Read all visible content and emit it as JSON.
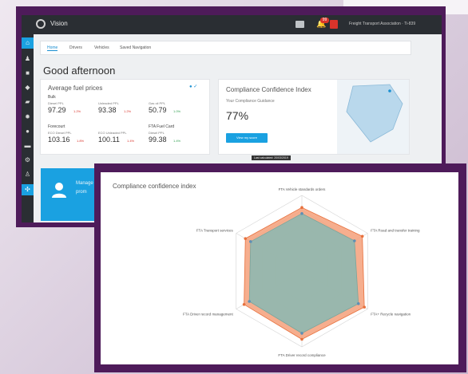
{
  "app": {
    "name": "Vision",
    "user": "Freight Transport Association · Ti-839",
    "notification_count": "99"
  },
  "nav_icons": [
    "home-icon",
    "person-icon",
    "truck-icon",
    "shirt-icon",
    "card-icon",
    "gear-icon",
    "chat-icon",
    "truck-icon",
    "tool-icon",
    "user-icon",
    "network-icon"
  ],
  "tabs": [
    "Home",
    "Drivers",
    "Vehicles",
    "Saved Navigation"
  ],
  "greeting": "Good afternoon",
  "fuel_card": {
    "title": "Average fuel prices",
    "section_bulk": "Bulk",
    "section_forecourt": "Forecourt",
    "section_fta": "FTA Fuel Card",
    "rows": [
      [
        {
          "label": "Diesel PPL",
          "value": "97.29",
          "change": "1.2%"
        },
        {
          "label": "Unleaded PPL",
          "value": "93.38",
          "change": "1.2%"
        },
        {
          "label": "Gas oil PPL",
          "value": "50.79",
          "change": "1.0%"
        }
      ],
      [
        {
          "label": "ECO Diesel PPL",
          "value": "103.16",
          "change": "1.8%"
        },
        {
          "label": "ECO Unleaded PPL",
          "value": "100.11",
          "change": "1.4%"
        },
        {
          "label": "Diesel PPL",
          "value": "99.38",
          "change": "1.4%"
        }
      ]
    ]
  },
  "cci_card": {
    "title": "Compliance Confidence Index",
    "subtitle": "Your Compliance Guidance",
    "value": "77%",
    "button": "View my score"
  },
  "tooltip": "Last calculated: 20/03/2019",
  "blue_card": {
    "line1": "Manage",
    "line2": "prom"
  },
  "radar": {
    "title": "Compliance confidence index"
  },
  "chart_data": {
    "type": "radar",
    "title": "Compliance confidence index",
    "axes": [
      "FTA Vehicle standards orders",
      "FTA Road and transfer training",
      "FTA+ Recycle navigation",
      "FTA Driver record compliance",
      "FTA Driver record management",
      "FTA Transport services"
    ],
    "range": [
      0,
      100
    ],
    "series": [
      {
        "values": [
          84,
          92,
          95,
          90,
          88,
          86
        ]
      },
      {
        "values": [
          76,
          80,
          86,
          82,
          80,
          78
        ]
      }
    ],
    "colors": {
      "outer": "#f4a07a",
      "inner": "#8fb8b0"
    }
  }
}
